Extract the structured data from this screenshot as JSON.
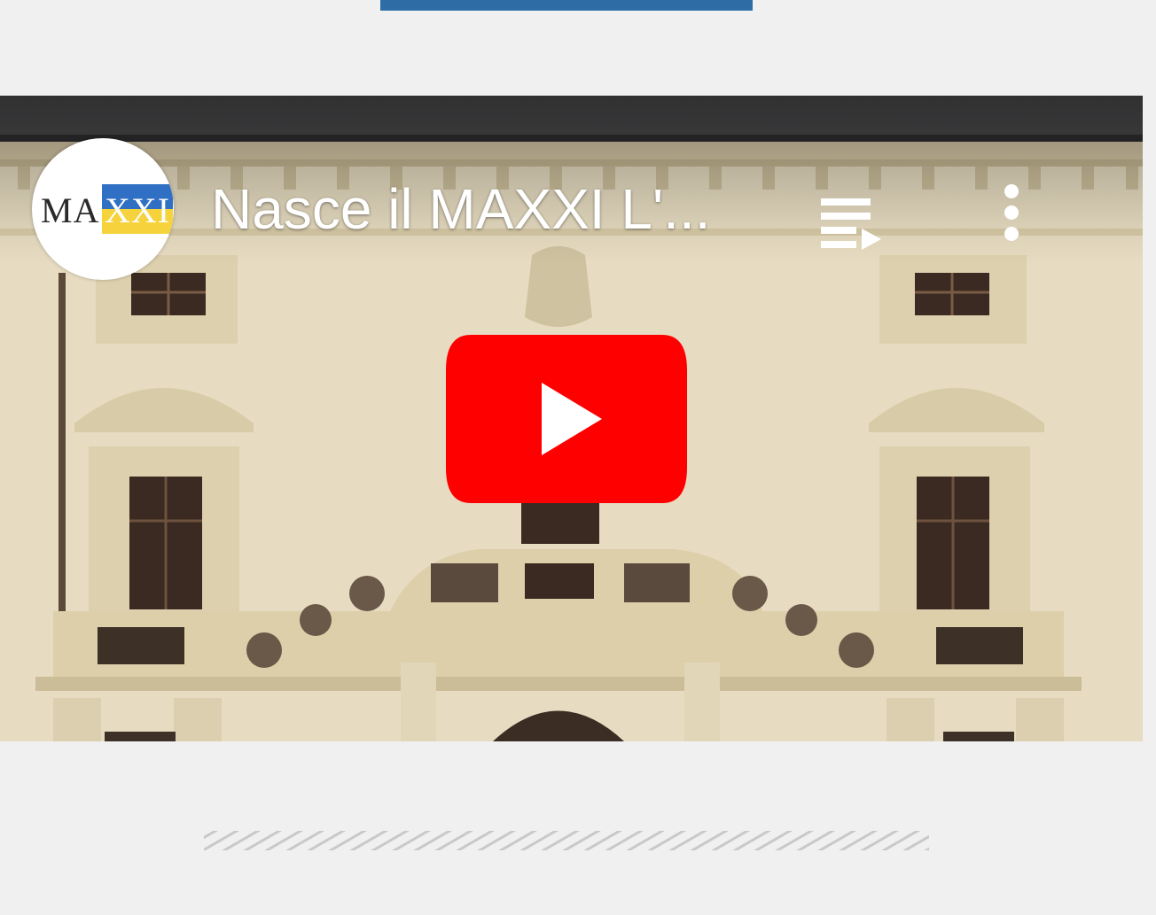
{
  "video": {
    "title": "Nasce il MAXXI L'...",
    "channel": {
      "logo_prefix": "MA",
      "logo_flag_text": "XXI",
      "flag_colors": [
        "#2f6fc4",
        "#f6d33d"
      ]
    },
    "controls": {
      "playlist_icon": "playlist-icon",
      "more_icon": "more-vert-icon",
      "play_icon": "youtube-play-icon"
    },
    "colors": {
      "play_button": "#ff0000",
      "accent_rule": "#2e6ca6"
    }
  }
}
